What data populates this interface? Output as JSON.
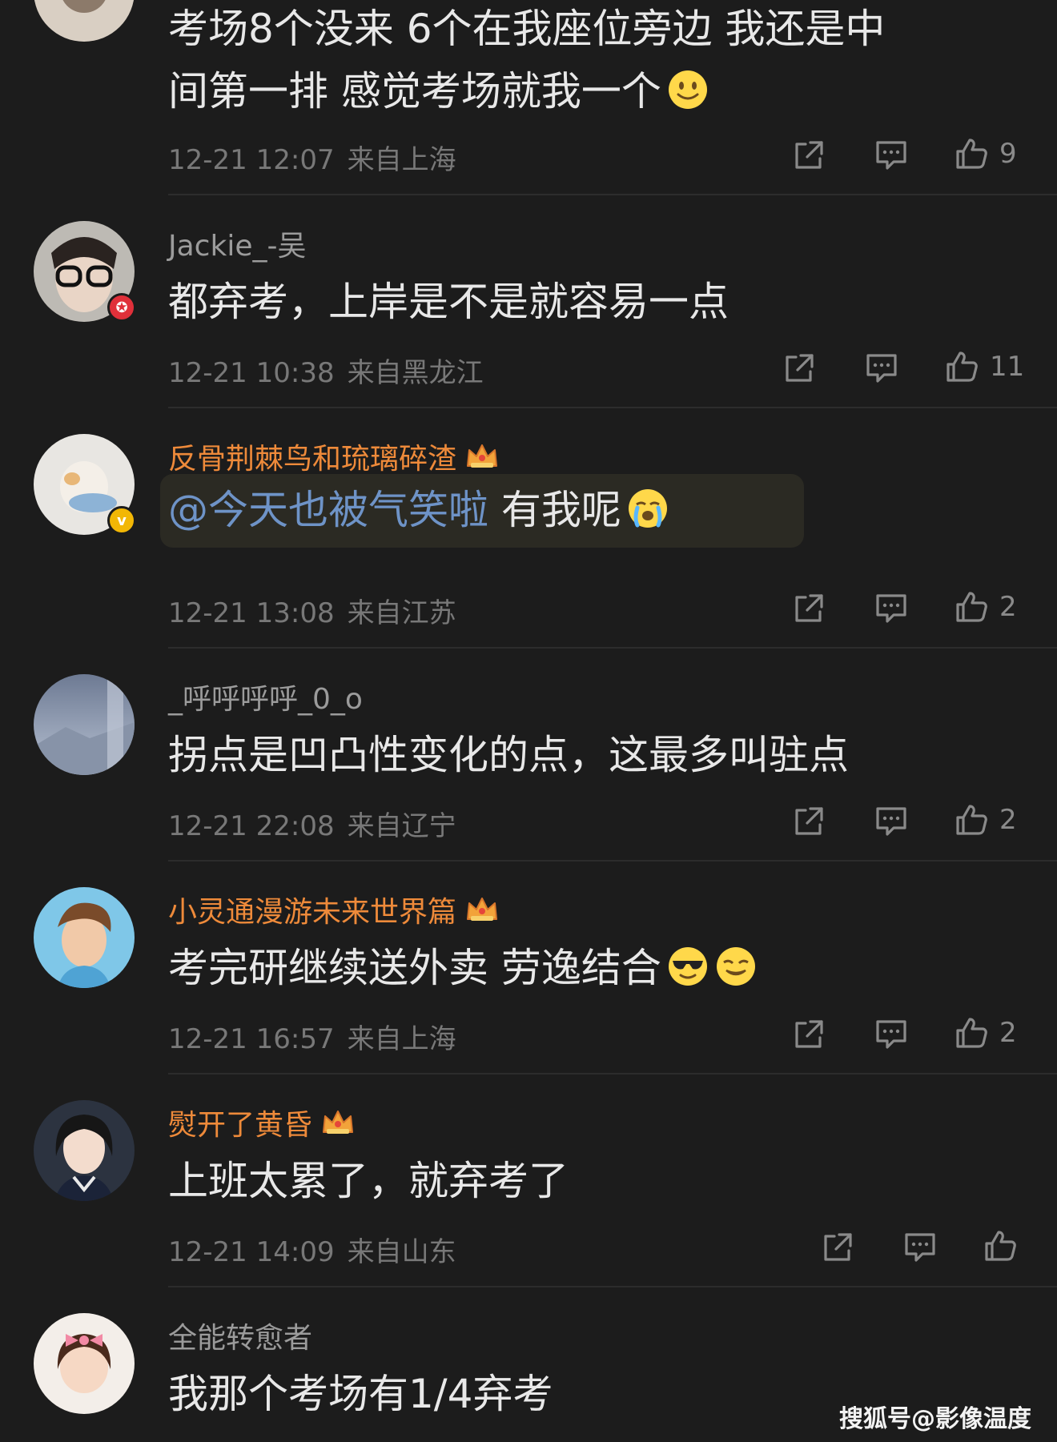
{
  "comments": [
    {
      "username": "",
      "text_line1": "考场8个没来 6个在我座位旁边 我还是中",
      "text_line2": "间第一排 感觉考场就我一个",
      "time": "12-21 12:07",
      "location": "来自上海",
      "likes": "9"
    },
    {
      "username": "Jackie_-吴",
      "text": "都弃考，上岸是不是就容易一点",
      "time": "12-21 10:38",
      "location": "来自黑龙江",
      "likes": "11"
    },
    {
      "username": "反骨荆棘鸟和琉璃碎渣",
      "mention": "@今天也被气笑啦",
      "text": " 有我呢",
      "time": "12-21 13:08",
      "location": "来自江苏",
      "likes": "2"
    },
    {
      "username": "_呼呼呼呼_0_o",
      "text": "拐点是凹凸性变化的点，这最多叫驻点",
      "time": "12-21 22:08",
      "location": "来自辽宁",
      "likes": "2"
    },
    {
      "username": "小灵通漫游未来世界篇",
      "text": "考完研继续送外卖 劳逸结合",
      "time": "12-21 16:57",
      "location": "来自上海",
      "likes": "2"
    },
    {
      "username": "熨开了黄昏",
      "text": "上班太累了，就弃考了",
      "time": "12-21 14:09",
      "location": "来自山东",
      "likes": ""
    },
    {
      "username": "全能转愈者",
      "text": "我那个考场有1/4弃考"
    }
  ],
  "watermark": "搜狐号@影像温度",
  "colors": {
    "background": "#1c1c1c",
    "vip_name": "#ee8a3a",
    "mention": "#6e93c7",
    "meta": "#787878"
  },
  "icons": [
    "share-icon",
    "reply-icon",
    "like-icon",
    "crown-icon",
    "smile-emoji",
    "crying-emoji",
    "cool-emoji",
    "smirk-emoji"
  ]
}
